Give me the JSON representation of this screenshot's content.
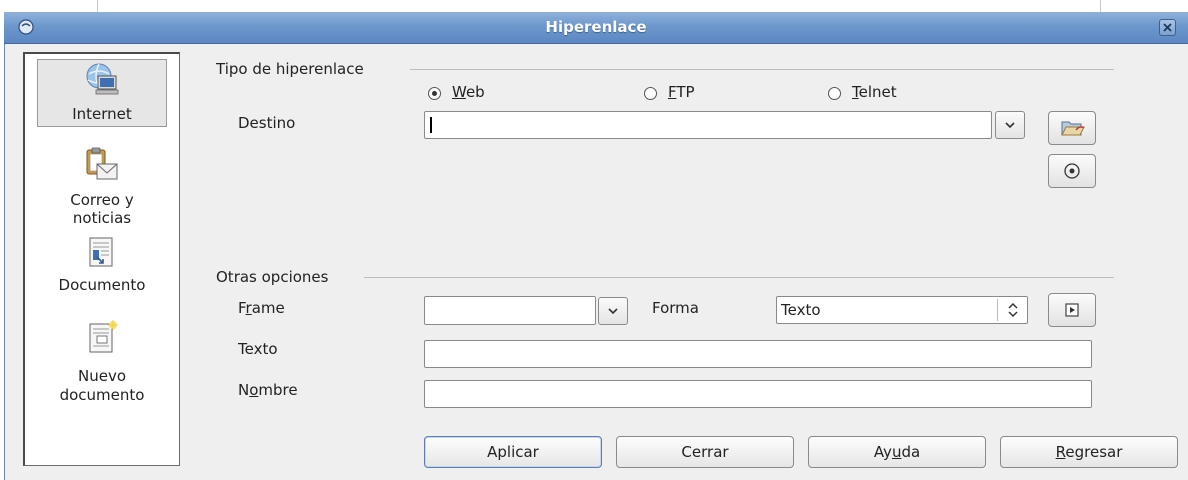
{
  "window": {
    "title": "Hiperenlace"
  },
  "sidebar": {
    "items": [
      {
        "label_lines": [
          "Internet"
        ],
        "icon": "internet-globe-computer-icon",
        "selected": true
      },
      {
        "label_lines": [
          "Correo y",
          "noticias"
        ],
        "icon": "mail-news-clipboard-icon",
        "selected": false
      },
      {
        "label_lines": [
          "Documento"
        ],
        "icon": "document-target-icon",
        "selected": false
      },
      {
        "label_lines": [
          "Nuevo",
          "documento"
        ],
        "icon": "new-document-icon",
        "selected": false
      }
    ]
  },
  "hyperlink_type": {
    "group_title": "Tipo de hiperenlace",
    "options": [
      {
        "label": "Web",
        "mnemonic": "W",
        "checked": true
      },
      {
        "label": "FTP",
        "mnemonic": "F",
        "checked": false
      },
      {
        "label": "Telnet",
        "mnemonic": "T",
        "checked": false
      }
    ],
    "target": {
      "label": "Destino",
      "value": ""
    }
  },
  "other_options": {
    "group_title": "Otras opciones",
    "frame": {
      "label": "Frame",
      "mnemonic": "r",
      "value": ""
    },
    "form": {
      "label": "Forma",
      "value": "Texto"
    },
    "text": {
      "label": "Texto",
      "value": ""
    },
    "name": {
      "label": "Nombre",
      "mnemonic": "o",
      "value": ""
    }
  },
  "buttons": {
    "apply": "Aplicar",
    "close": "Cerrar",
    "help": "Ayuda",
    "help_mnemonic": "u",
    "back": "Regresar",
    "back_mnemonic": "R"
  },
  "colors": {
    "titlebar": "#6d97cc",
    "dialog_bg": "#efefef"
  }
}
